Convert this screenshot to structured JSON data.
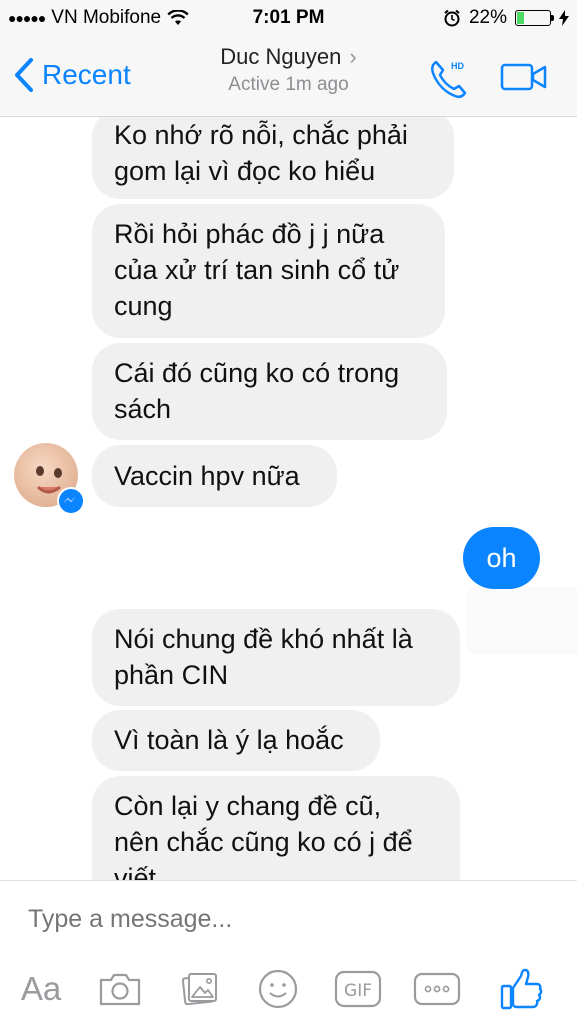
{
  "status_bar": {
    "carrier": "VN Mobifone",
    "time": "7:01 PM",
    "battery_percent": "22%",
    "battery_level": 0.22
  },
  "nav": {
    "back_label": "Recent",
    "contact_name": "Duc Nguyen",
    "status": "Active 1m ago"
  },
  "messages": [
    {
      "sender": "them",
      "lines": [
        "Ko nhớ rõ nỗi, chắc phải",
        "gom lại vì đọc ko hiểu"
      ]
    },
    {
      "sender": "them",
      "lines": [
        "Rồi hỏi phác đồ j j nữa",
        "của xử trí tan sinh cổ tử",
        "cung"
      ]
    },
    {
      "sender": "them",
      "lines": [
        "Cái đó cũng ko có trong",
        "sách"
      ]
    },
    {
      "sender": "them",
      "lines": [
        "Vaccin hpv nữa"
      ]
    },
    {
      "sender": "me",
      "lines": [
        "oh"
      ]
    },
    {
      "sender": "them",
      "lines": [
        "Nói chung đề khó nhất là",
        "phần CIN"
      ]
    },
    {
      "sender": "them",
      "lines": [
        "Vì toàn là ý lạ hoắc"
      ]
    },
    {
      "sender": "them",
      "lines": [
        "Còn lại y chang đề cũ,",
        "nên chắc cũng ko có j để",
        "viết"
      ]
    }
  ],
  "composer": {
    "placeholder": "Type a message...",
    "aa_label": "Aa",
    "icons": [
      "text-format-icon",
      "camera-icon",
      "photo-icon",
      "emoji-icon",
      "gif-icon",
      "more-icon",
      "like-icon"
    ]
  },
  "colors": {
    "accent": "#0a84ff",
    "incoming_bubble": "#f1f0f0",
    "bar_background": "#f7f7f8"
  }
}
